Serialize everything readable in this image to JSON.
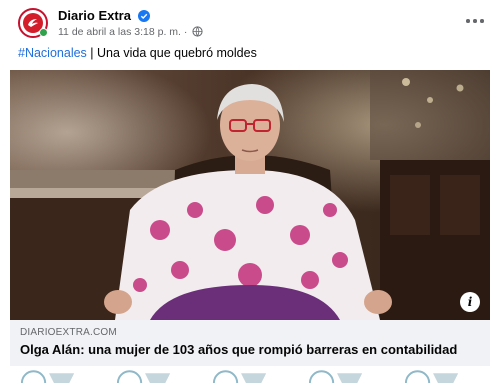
{
  "post": {
    "page_name": "Diario Extra",
    "timestamp": "11 de abril a las 3:18 p. m.",
    "hashtag": "#Nacionales",
    "caption_rest": " | Una vida que quebró moldes"
  },
  "link_preview": {
    "domain": "DIARIOEXTRA.COM",
    "headline": "Olga Alán: una mujer de 103 años que rompió barreras en contabilidad"
  },
  "colors": {
    "brand_red": "#d31d2b",
    "verified_blue": "#1877f2",
    "hashtag_blue": "#216fdb",
    "online_green": "#31a24c"
  },
  "icons": [
    "verified-badge-icon",
    "globe-icon",
    "more-options-icon",
    "info-icon",
    "page-logo-icon"
  ]
}
